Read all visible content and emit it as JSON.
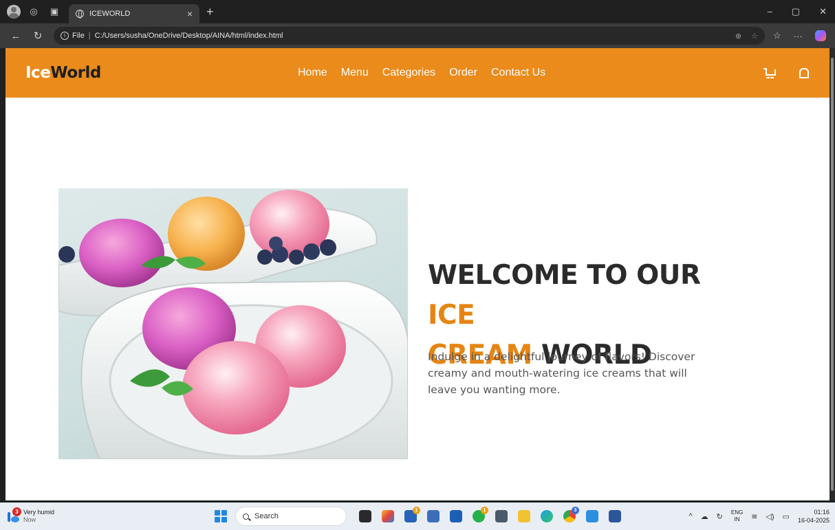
{
  "browser": {
    "tab_title": "ICEWORLD",
    "tab_close": "×",
    "new_tab": "+",
    "address_prefix": "File",
    "address_path": "C:/Users/susha/OneDrive/Desktop/AINA/html/index.html",
    "window_controls": [
      "–",
      "▢",
      "✕"
    ]
  },
  "site": {
    "logo": {
      "part1": "Ice",
      "part2": "World"
    },
    "nav": [
      "Home",
      "Menu",
      "Categories",
      "Order",
      "Contact Us"
    ],
    "header_icons": [
      "cart-icon",
      "bell-icon"
    ],
    "brand_color": "#ea8b1c",
    "accent_color": "#e58514"
  },
  "hero": {
    "title_part1": "WELCOME TO OUR ",
    "title_accent1": "ICE",
    "title_accent2": "CREAM",
    "title_part2": " WORLD",
    "description": "Indulge in a delightful journey of flavors! Discover creamy and mouth-watering ice creams that will leave you wanting more.",
    "image_subject": "plates-of-pink-and-orange-ice-cream-scoops-with-blueberries-and-mint"
  },
  "taskbar": {
    "weather_badge": "3",
    "weather_text": "Very humid",
    "weather_sub": "Now",
    "search_label": "Search",
    "tray_lang_line1": "ENG",
    "tray_lang_line2": "IN",
    "clock_time": "01:16",
    "clock_date": "16-04-2025",
    "app_badges": {
      "second_app": "1",
      "whatsapp": "1",
      "chrome": "3"
    }
  }
}
